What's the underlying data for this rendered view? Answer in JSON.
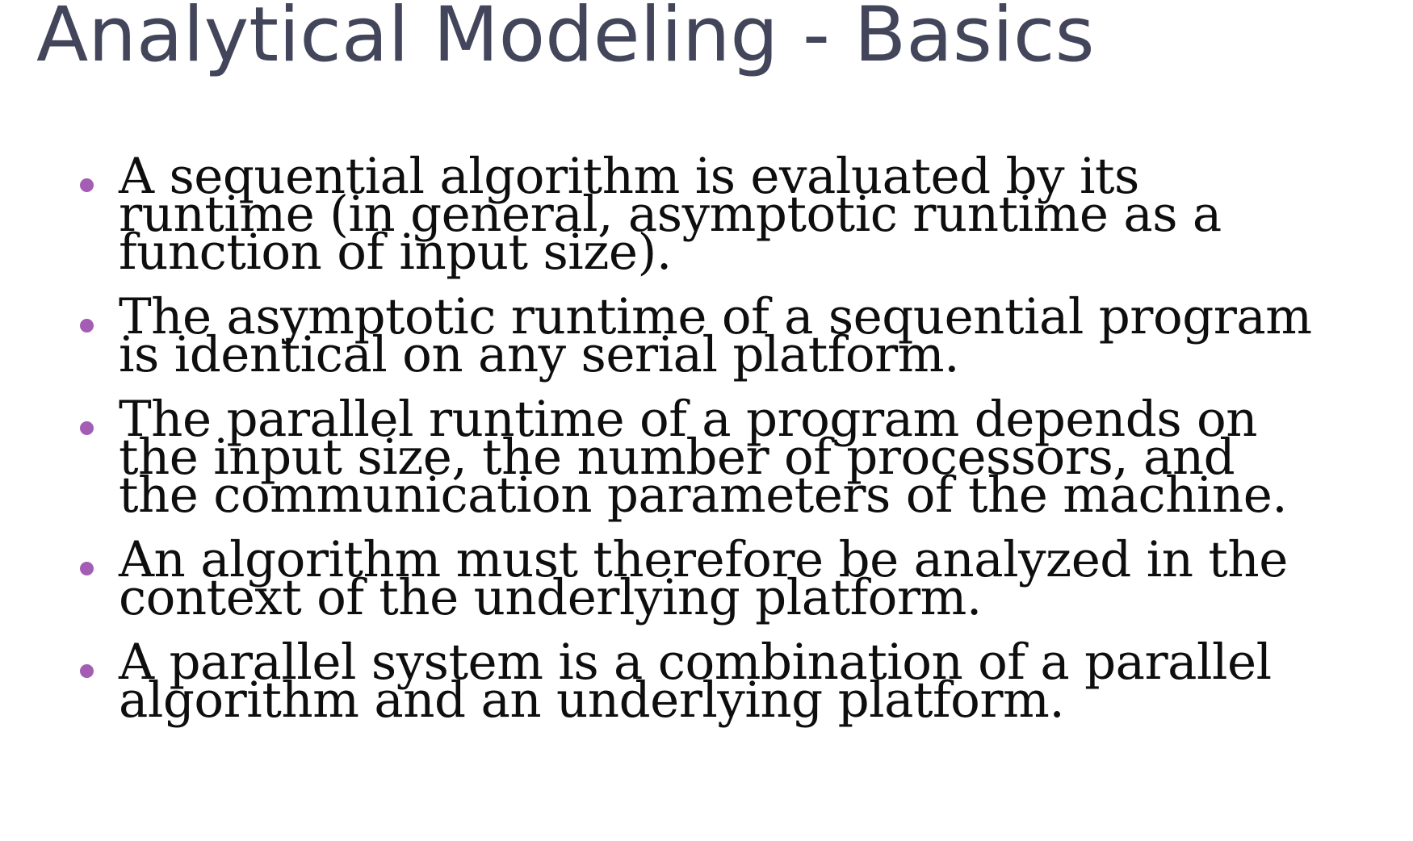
{
  "slide": {
    "title": "Analytical Modeling - Basics",
    "bullets": [
      {
        "text": "A sequential algorithm is evaluated by its runtime (in general, asymptotic runtime as a function of input size)."
      },
      {
        "text": "The asymptotic runtime of a sequential program is identical on any serial platform."
      },
      {
        "text": "The parallel runtime of a program depends on the input size, the number of processors, and the communication parameters of the machine."
      },
      {
        "text": "An algorithm must therefore be analyzed in the context of the underlying platform."
      },
      {
        "text": "A parallel system is a combination of a parallel algorithm and an underlying platform."
      }
    ]
  },
  "colors": {
    "title": "#43465a",
    "bullet_dot": "#a45db4",
    "body_text": "#0e0e0e",
    "background": "#ffffff"
  }
}
